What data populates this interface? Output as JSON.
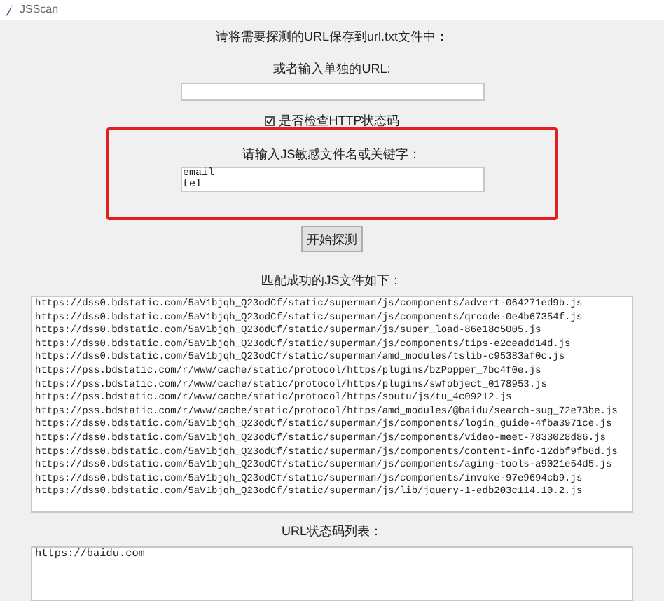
{
  "window": {
    "title": "JSScan"
  },
  "url_file_label": "请将需要探测的URL保存到url.txt文件中：",
  "single_url_label": "或者输入单独的URL:",
  "check_http": {
    "label": "是否检查HTTP状态码",
    "checked": true
  },
  "keyword_label": "请输入JS敏感文件名或关键字：",
  "keyword_field": {
    "lines": [
      "email",
      "tel"
    ]
  },
  "start_button": "开始探测",
  "matched_label": "匹配成功的JS文件如下：",
  "matched_files": [
    "https://dss0.bdstatic.com/5aV1bjqh_Q23odCf/static/superman/js/components/advert-064271ed9b.js",
    "https://dss0.bdstatic.com/5aV1bjqh_Q23odCf/static/superman/js/components/qrcode-0e4b67354f.js",
    "https://dss0.bdstatic.com/5aV1bjqh_Q23odCf/static/superman/js/super_load-86e18c5005.js",
    "https://dss0.bdstatic.com/5aV1bjqh_Q23odCf/static/superman/js/components/tips-e2ceadd14d.js",
    "https://dss0.bdstatic.com/5aV1bjqh_Q23odCf/static/superman/amd_modules/tslib-c95383af0c.js",
    "https://pss.bdstatic.com/r/www/cache/static/protocol/https/plugins/bzPopper_7bc4f0e.js",
    "https://pss.bdstatic.com/r/www/cache/static/protocol/https/plugins/swfobject_0178953.js",
    "https://pss.bdstatic.com/r/www/cache/static/protocol/https/soutu/js/tu_4c09212.js",
    "https://pss.bdstatic.com/r/www/cache/static/protocol/https/amd_modules/@baidu/search-sug_72e73be.js",
    "https://dss0.bdstatic.com/5aV1bjqh_Q23odCf/static/superman/js/components/login_guide-4fba3971ce.js",
    "https://dss0.bdstatic.com/5aV1bjqh_Q23odCf/static/superman/js/components/video-meet-7833028d86.js",
    "https://dss0.bdstatic.com/5aV1bjqh_Q23odCf/static/superman/js/components/content-info-12dbf9fb6d.js",
    "https://dss0.bdstatic.com/5aV1bjqh_Q23odCf/static/superman/js/components/aging-tools-a9021e54d5.js",
    "https://dss0.bdstatic.com/5aV1bjqh_Q23odCf/static/superman/js/components/invoke-97e9694cb9.js",
    "https://dss0.bdstatic.com/5aV1bjqh_Q23odCf/static/superman/js/lib/jquery-1-edb203c114.10.2.js"
  ],
  "status_label": "URL状态码列表：",
  "status_list": [
    "https://baidu.com"
  ]
}
